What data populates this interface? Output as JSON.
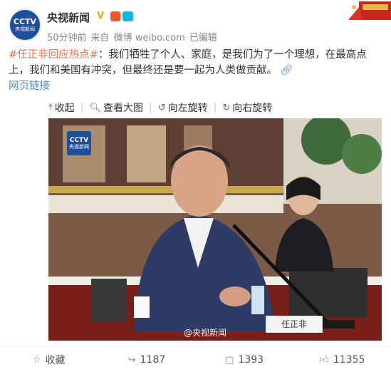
{
  "header": {
    "account_name": "央视新闻",
    "avatar_text_top": "CCTV",
    "avatar_text_bottom": "央视新闻",
    "time": "50分钟前",
    "source_prefix": "来自",
    "source": "微博 weibo.com",
    "edited": "已编辑"
  },
  "post": {
    "hashtag": "#任正非回应热点#",
    "text": "：我们牺牲了个人、家庭，是我们为了一个理想，在最高点上，我们和美国有冲突，但最终还是要一起为人类做贡献。",
    "web_link": "网页链接"
  },
  "toolbar": {
    "collapse": "收起",
    "view_large": "查看大图",
    "rotate_left": "向左旋转",
    "rotate_right": "向右旋转"
  },
  "photo": {
    "logo_top": "CCTV",
    "logo_bottom": "央视新闻",
    "watermark": "@央视新闻",
    "nameplate": "任正非"
  },
  "footer": {
    "favorite": "收藏",
    "reposts": "1187",
    "comments": "1393",
    "likes": "11355"
  },
  "icons": {
    "verified": "verified-v-icon",
    "link": "link-icon",
    "collapse": "arrow-up-icon",
    "zoom": "magnifier-icon",
    "rotate_left": "rotate-left-icon",
    "rotate_right": "rotate-right-icon",
    "favorite": "star-icon",
    "repost": "repost-icon",
    "comment": "comment-icon",
    "like": "thumbs-up-icon"
  },
  "colors": {
    "hashtag": "#eb7350",
    "link": "#5b8ac8",
    "brand_blue": "#1f4f9a"
  }
}
